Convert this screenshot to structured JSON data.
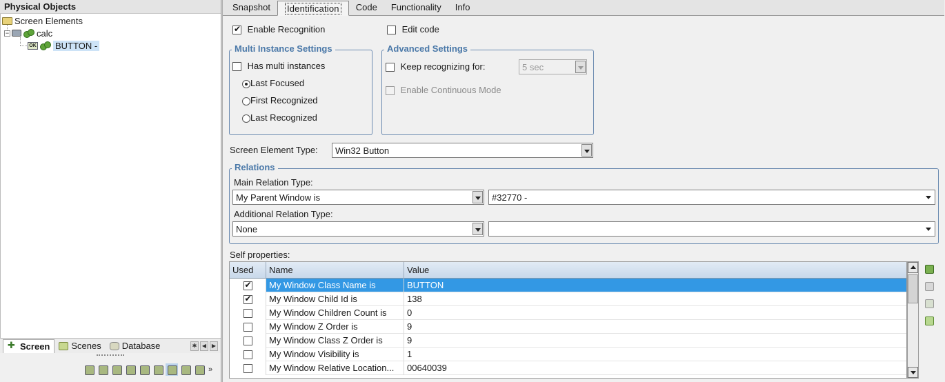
{
  "left_panel": {
    "title": "Physical Objects",
    "tree": {
      "root_label": "Screen Elements",
      "child_label": "calc",
      "leaf_label": "BUTTON -"
    },
    "tabs": [
      "Screen",
      "Scenes",
      "Database"
    ]
  },
  "tabs": [
    "Snapshot",
    "Identification",
    "Code",
    "Functionality",
    "Info"
  ],
  "active_tab": "Identification",
  "identification": {
    "enable_recognition_label": "Enable Recognition",
    "enable_recognition_checked": true,
    "edit_code_label": "Edit code",
    "edit_code_checked": false,
    "multi_instance": {
      "title": "Multi Instance Settings",
      "has_multi_label": "Has multi instances",
      "options": [
        "Last Focused",
        "First Recognized",
        "Last Recognized"
      ],
      "selected": "Last Focused"
    },
    "advanced": {
      "title": "Advanced Settings",
      "keep_label": "Keep recognizing for:",
      "keep_value": "5 sec",
      "continuous_label": "Enable Continuous Mode"
    },
    "element_type_label": "Screen Element Type:",
    "element_type_value": "Win32 Button",
    "relations": {
      "title": "Relations",
      "main_label": "Main Relation Type:",
      "main_type": "My Parent Window is",
      "main_target": "#32770 -",
      "additional_label": "Additional Relation Type:",
      "additional_type": "None",
      "additional_target": ""
    },
    "self_properties_label": "Self properties:",
    "table": {
      "headers": [
        "Used",
        "Name",
        "Value"
      ],
      "rows": [
        {
          "used": true,
          "name": "My Window Class Name is",
          "value": "BUTTON"
        },
        {
          "used": true,
          "name": "My Window Child Id is",
          "value": "138"
        },
        {
          "used": false,
          "name": "My Window Children Count is",
          "value": "0"
        },
        {
          "used": false,
          "name": "My Window Z Order is",
          "value": "9"
        },
        {
          "used": false,
          "name": "My Window Class Z Order is",
          "value": "9"
        },
        {
          "used": false,
          "name": "My Window Visibility is",
          "value": "1"
        },
        {
          "used": false,
          "name": "My Window Relative Location...",
          "value": "00640039"
        }
      ],
      "selected_row": 0
    }
  }
}
